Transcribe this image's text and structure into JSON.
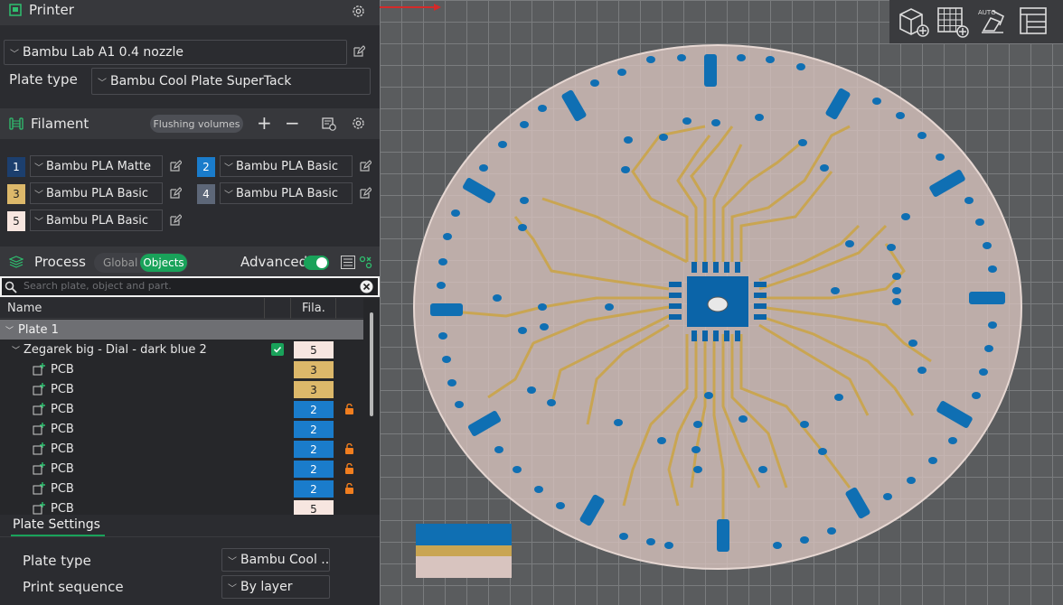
{
  "printer": {
    "title": "Printer",
    "selected": "Bambu Lab A1 0.4 nozzle",
    "plate_type_label": "Plate type",
    "plate_type_value": "Bambu Cool Plate SuperTack"
  },
  "filament": {
    "title": "Filament",
    "flushing_label": "Flushing volumes",
    "add_symbol": "+",
    "remove_symbol": "−",
    "items": [
      {
        "num": "1",
        "name": "Bambu PLA Matte",
        "color": "#1c3f6e",
        "text_color": "#ffffff"
      },
      {
        "num": "2",
        "name": "Bambu PLA Basic",
        "color": "#1a7ccb",
        "text_color": "#ffffff"
      },
      {
        "num": "3",
        "name": "Bambu PLA Basic",
        "color": "#dcb86a",
        "text_color": "#222222"
      },
      {
        "num": "4",
        "name": "Bambu PLA Basic",
        "color": "#5d6778",
        "text_color": "#ffffff"
      },
      {
        "num": "5",
        "name": "Bambu PLA Basic",
        "color": "#f7e6e0",
        "text_color": "#222222"
      }
    ]
  },
  "process": {
    "title": "Process",
    "global_label": "Global",
    "objects_label": "Objects",
    "advanced_label": "Advanced",
    "advanced_on": true,
    "search_placeholder": "Search plate, object and part."
  },
  "object_list": {
    "col_name": "Name",
    "col_fila": "Fila.",
    "plate": "Plate 1",
    "object": {
      "name": "Zegarek big - Dial - dark blue 2",
      "fila": "5",
      "checked": true
    },
    "parts": [
      {
        "name": "PCB",
        "fila": "3",
        "locked": false
      },
      {
        "name": "PCB",
        "fila": "3",
        "locked": false
      },
      {
        "name": "PCB",
        "fila": "2",
        "locked": true
      },
      {
        "name": "PCB",
        "fila": "2",
        "locked": false
      },
      {
        "name": "PCB",
        "fila": "2",
        "locked": true
      },
      {
        "name": "PCB",
        "fila": "2",
        "locked": true
      },
      {
        "name": "PCB",
        "fila": "2",
        "locked": true
      },
      {
        "name": "PCB",
        "fila": "5",
        "locked": false
      }
    ]
  },
  "plate_settings": {
    "title": "Plate Settings",
    "plate_type_label": "Plate type",
    "plate_type_value": "Bambu Cool ...",
    "print_sequence_label": "Print sequence",
    "print_sequence_value": "By layer"
  },
  "viewport": {
    "toolbar_icons": [
      "add-plate-icon",
      "arrange-grid-icon",
      "auto-orient-icon",
      "layout-icon"
    ],
    "toolbar_auto_text": "AUTO",
    "colors": {
      "dial": "#dcc6c1",
      "trace": "#c9a552",
      "pad": "#0f6fb3",
      "chip": "#0b64a8",
      "grid": "#7a7c7e",
      "bed": "#5a5c5e"
    }
  }
}
